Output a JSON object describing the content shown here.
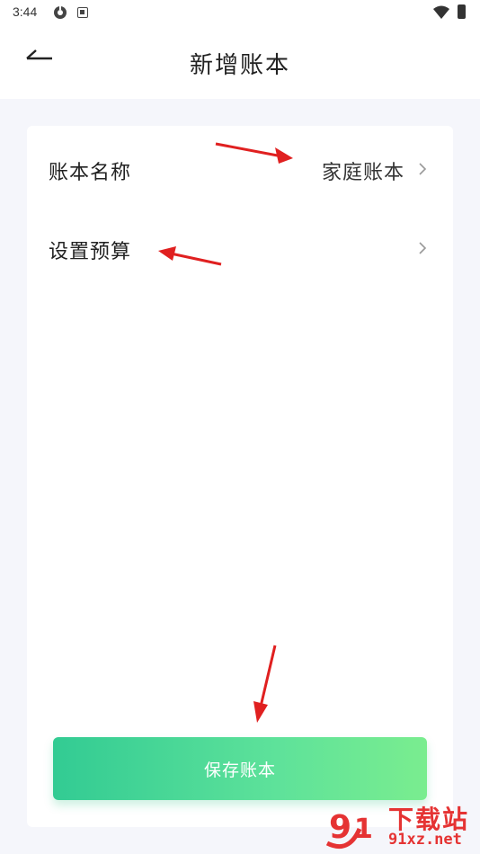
{
  "status_bar": {
    "time": "3:44"
  },
  "header": {
    "title": "新增账本",
    "back_icon": "arrow-left-icon"
  },
  "rows": [
    {
      "label": "账本名称",
      "value": "家庭账本"
    },
    {
      "label": "设置预算",
      "value": ""
    }
  ],
  "save_button": {
    "label": "保存账本"
  },
  "colors": {
    "accent_start": "#32cb93",
    "accent_end": "#7aed8f",
    "annotation": "#e02020"
  },
  "watermark": {
    "title": "下载站",
    "url": "91xz.net"
  }
}
